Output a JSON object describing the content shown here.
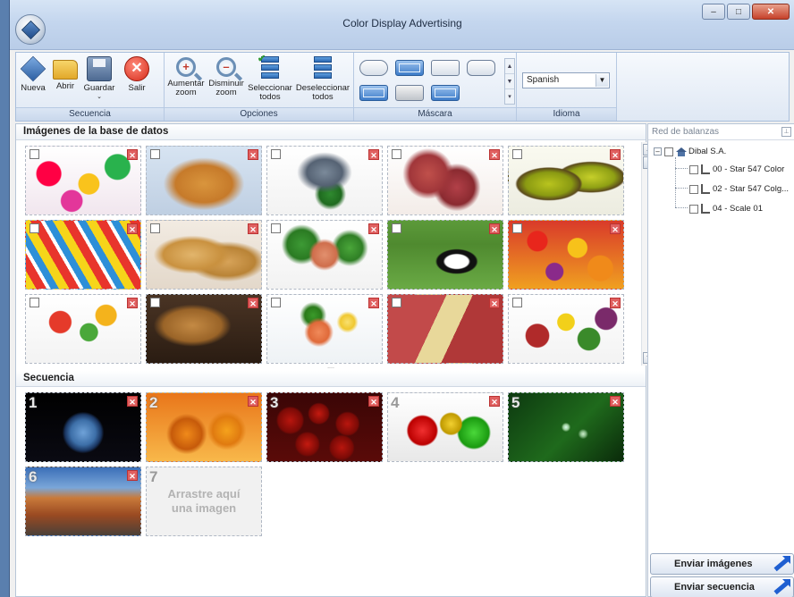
{
  "window": {
    "title": "Color Display Advertising"
  },
  "ribbon": {
    "groups": {
      "secuencia": "Secuencia",
      "opciones": "Opciones",
      "mascara": "Máscara",
      "idioma": "Idioma"
    },
    "buttons": {
      "nueva": "Nueva",
      "abrir": "Abrir",
      "guardar": "Guardar",
      "salir": "Salir",
      "aumentar_zoom_1": "Aumentar",
      "aumentar_zoom_2": "zoom",
      "disminuir_zoom_1": "Disminuir",
      "disminuir_zoom_2": "zoom",
      "seleccionar_1": "Seleccionar",
      "seleccionar_2": "todos",
      "deseleccionar_1": "Deseleccionar",
      "deseleccionar_2": "todos"
    },
    "language": "Spanish"
  },
  "database": {
    "title": "Imágenes de la base de datos",
    "images": [
      {
        "subject": "candies"
      },
      {
        "subject": "croissants"
      },
      {
        "subject": "fish"
      },
      {
        "subject": "salami"
      },
      {
        "subject": "kiwi"
      },
      {
        "subject": "lollipops"
      },
      {
        "subject": "bread"
      },
      {
        "subject": "salmon-salad"
      },
      {
        "subject": "cow"
      },
      {
        "subject": "fruit-assortment"
      },
      {
        "subject": "jelly-candies"
      },
      {
        "subject": "bread-basket"
      },
      {
        "subject": "shrimp-plate"
      },
      {
        "subject": "ham-cheese"
      },
      {
        "subject": "vegetables"
      }
    ]
  },
  "sequence": {
    "title": "Secuencia",
    "items": [
      {
        "number": "1",
        "subject": "earth"
      },
      {
        "number": "2",
        "subject": "orange-jam"
      },
      {
        "number": "3",
        "subject": "apples"
      },
      {
        "number": "4",
        "subject": "glass-apples"
      },
      {
        "number": "5",
        "subject": "water-drops"
      },
      {
        "number": "6",
        "subject": "canyon-road"
      }
    ],
    "placeholder_number": "7",
    "placeholder_line1": "Arrastre aquí",
    "placeholder_line2": "una imagen"
  },
  "side_panel": {
    "title": "Red de balanzas",
    "root": "Dibal S.A.",
    "scales": [
      "00 - Star 547 Color",
      "02 - Star 547 Colg...",
      "04 - Scale 01"
    ],
    "send_images": "Enviar imágenes",
    "send_sequence": "Enviar secuencia"
  }
}
